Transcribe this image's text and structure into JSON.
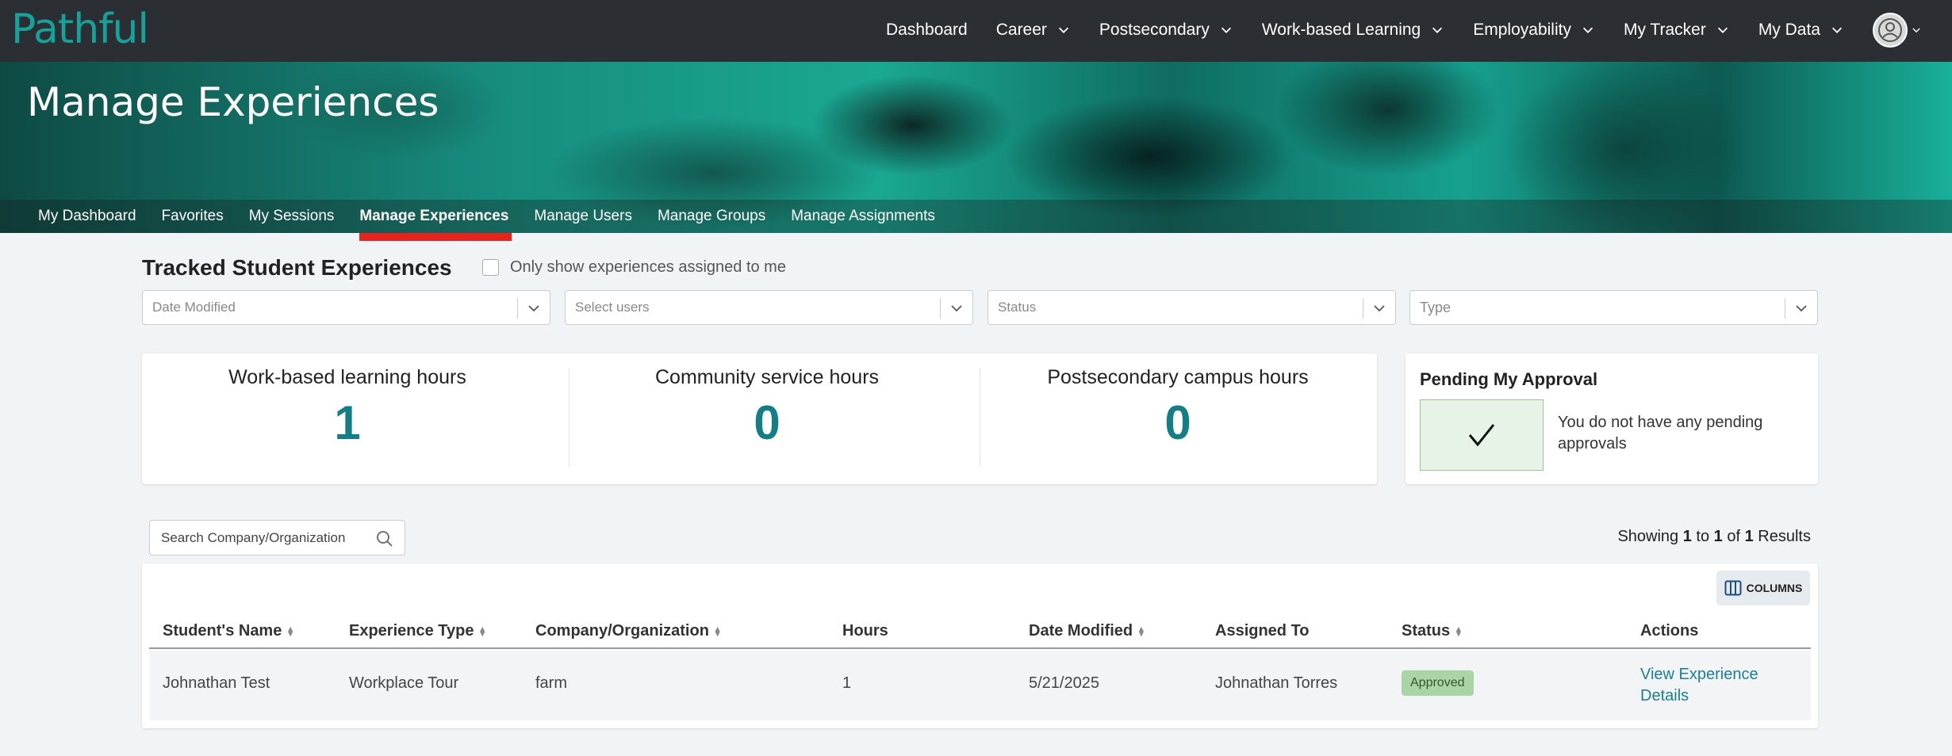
{
  "topnav": {
    "logo": "Pathful",
    "items": [
      {
        "label": "Dashboard",
        "dropdown": false
      },
      {
        "label": "Career",
        "dropdown": true
      },
      {
        "label": "Postsecondary",
        "dropdown": true
      },
      {
        "label": "Work-based Learning",
        "dropdown": true
      },
      {
        "label": "Employability",
        "dropdown": true
      },
      {
        "label": "My Tracker",
        "dropdown": true
      },
      {
        "label": "My Data",
        "dropdown": true
      }
    ]
  },
  "hero": {
    "title": "Manage Experiences"
  },
  "subnav": {
    "items": [
      "My Dashboard",
      "Favorites",
      "My Sessions",
      "Manage Experiences",
      "Manage Users",
      "Manage Groups",
      "Manage Assignments"
    ],
    "active": "Manage Experiences"
  },
  "section": {
    "title": "Tracked Student Experiences",
    "only_assigned_label": "Only show experiences assigned to me"
  },
  "filters": {
    "date_modified": "Date Modified",
    "users": "Select users",
    "status": "Status",
    "type": "Type"
  },
  "stats": {
    "wbl_label": "Work-based learning hours",
    "wbl_value": "1",
    "community_label": "Community service hours",
    "community_value": "0",
    "campus_label": "Postsecondary campus hours",
    "campus_value": "0"
  },
  "pending": {
    "title": "Pending My Approval",
    "message": "You do not have any pending approvals"
  },
  "search": {
    "placeholder": "Search Company/Organization"
  },
  "results": {
    "prefix": "Showing",
    "from": "1",
    "to_word": "to",
    "to": "1",
    "of_word": "of",
    "total": "1",
    "suffix": "Results"
  },
  "table": {
    "columns_button": "COLUMNS",
    "headers": {
      "student": "Student's Name",
      "type": "Experience Type",
      "company": "Company/Organization",
      "hours": "Hours",
      "date": "Date Modified",
      "assigned": "Assigned To",
      "status": "Status",
      "actions": "Actions"
    },
    "rows": [
      {
        "student": "Johnathan Test",
        "type": "Workplace Tour",
        "company": "farm",
        "hours": "1",
        "date": "5/21/2025",
        "assigned": "Johnathan Torres",
        "status": "Approved",
        "action": "View Experience Details"
      }
    ]
  },
  "colors": {
    "topbar": "#2b2f33",
    "brand_teal": "#14a39a",
    "stat_teal": "#137e86",
    "active_underline": "#e8231e",
    "link": "#1a7e96",
    "approved_badge": "#a9d4a6"
  }
}
